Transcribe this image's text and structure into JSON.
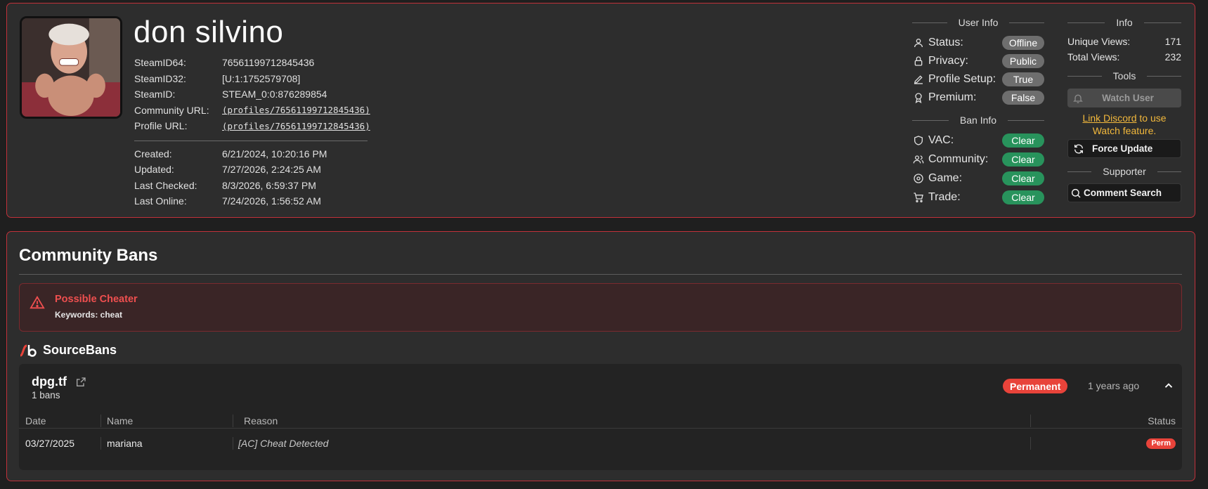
{
  "profile": {
    "username": "don silvino",
    "ids": [
      {
        "key": "SteamID64:",
        "value": "76561199712845436"
      },
      {
        "key": "SteamID32:",
        "value": "[U:1:1752579708]"
      },
      {
        "key": "SteamID:",
        "value": "STEAM_0:0:876289854"
      },
      {
        "key": "Community URL:",
        "value": "(profiles/76561199712845436)"
      },
      {
        "key": "Profile URL:",
        "value": "(profiles/76561199712845436)"
      }
    ],
    "dates": [
      {
        "key": "Created:",
        "value": "6/21/2024, 10:20:16 PM"
      },
      {
        "key": "Updated:",
        "value": "7/27/2026, 2:24:25 AM"
      },
      {
        "key": "Last Checked:",
        "value": "8/3/2026, 6:59:37 PM"
      },
      {
        "key": "Last Online:",
        "value": "7/24/2026, 1:56:52 AM"
      }
    ]
  },
  "user_info": {
    "title": "User Info",
    "rows": [
      {
        "icon": "user-icon",
        "label": "Status:",
        "value": "Offline"
      },
      {
        "icon": "lock-icon",
        "label": "Privacy:",
        "value": "Public"
      },
      {
        "icon": "pencil-icon",
        "label": "Profile Setup:",
        "value": "True"
      },
      {
        "icon": "award-icon",
        "label": "Premium:",
        "value": "False"
      }
    ]
  },
  "ban_info": {
    "title": "Ban Info",
    "rows": [
      {
        "icon": "shield-icon",
        "label": "VAC:",
        "value": "Clear"
      },
      {
        "icon": "users-icon",
        "label": "Community:",
        "value": "Clear"
      },
      {
        "icon": "disc-icon",
        "label": "Game:",
        "value": "Clear"
      },
      {
        "icon": "cart-icon",
        "label": "Trade:",
        "value": "Clear"
      }
    ]
  },
  "info": {
    "title": "Info",
    "unique_views_label": "Unique Views:",
    "unique_views": "171",
    "total_views_label": "Total Views:",
    "total_views": "232"
  },
  "tools": {
    "title": "Tools",
    "watch_label": "Watch User",
    "discord_link": "Link Discord",
    "discord_rest": " to use Watch feature.",
    "force_update_label": "Force Update"
  },
  "supporter": {
    "title": "Supporter",
    "comment_search_label": "Comment Search"
  },
  "community_bans": {
    "title": "Community Bans",
    "alert_title": "Possible Cheater",
    "alert_keywords": "Keywords: cheat"
  },
  "sourcebans": {
    "title": "SourceBans",
    "server": "dpg.tf",
    "ban_count": "1 bans",
    "badge": "Permanent",
    "ago": "1 years ago",
    "columns": {
      "date": "Date",
      "name": "Name",
      "reason": "Reason",
      "status": "Status"
    },
    "rows": [
      {
        "date": "03/27/2025",
        "name": "mariana",
        "reason": "[AC] Cheat Detected",
        "status": "Perm"
      }
    ]
  },
  "colors": {
    "accent_border": "#c0313a",
    "clear_green": "#28935c",
    "perm_red": "#e8433a",
    "discord_yellow": "#f2b83c",
    "alert_red": "#ef4f4f"
  }
}
